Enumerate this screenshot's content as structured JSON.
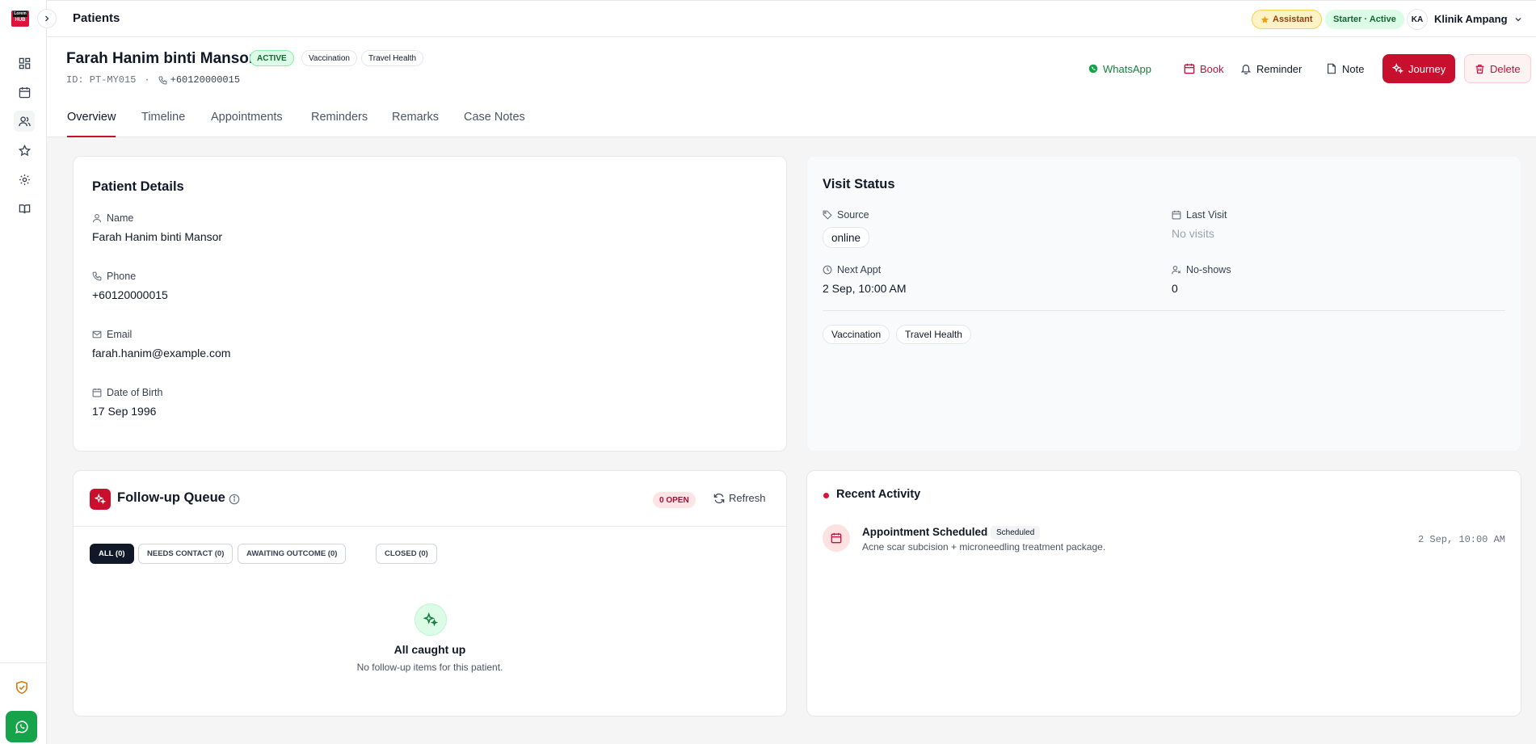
{
  "app": {
    "logo_top": "Lorem",
    "logo_bottom": "HUB"
  },
  "topbar": {
    "title": "Patients",
    "assistant_label": "Assistant",
    "plan_label": "Starter · Active",
    "avatar_initials": "KA",
    "clinic_name": "Klinik Ampang"
  },
  "patient": {
    "name": "Farah Hanim binti Mansor",
    "status_badge": "ACTIVE",
    "tags": [
      "Vaccination",
      "Travel Health"
    ],
    "id_label": "ID: PT-MY015",
    "separator": "·",
    "phone": "+60120000015"
  },
  "actions": {
    "whatsapp": "WhatsApp",
    "book": "Book",
    "reminder": "Reminder",
    "note": "Note",
    "journey": "Journey",
    "delete": "Delete"
  },
  "tabs": [
    "Overview",
    "Timeline",
    "Appointments",
    "Reminders",
    "Remarks",
    "Case Notes"
  ],
  "patient_details": {
    "title": "Patient Details",
    "name_label": "Name",
    "name_value": "Farah Hanim binti Mansor",
    "phone_label": "Phone",
    "phone_value": "+60120000015",
    "email_label": "Email",
    "email_value": "farah.hanim@example.com",
    "dob_label": "Date of Birth",
    "dob_value": "17 Sep 1996"
  },
  "visit_status": {
    "title": "Visit Status",
    "source_label": "Source",
    "source_value": "online",
    "last_visit_label": "Last Visit",
    "last_visit_value": "No visits",
    "next_appt_label": "Next Appt",
    "next_appt_value": "2 Sep, 10:00 AM",
    "noshows_label": "No-shows",
    "noshows_value": "0",
    "tags": [
      "Vaccination",
      "Travel Health"
    ]
  },
  "followup": {
    "title": "Follow-up Queue",
    "open_count": "0 OPEN",
    "refresh_label": "Refresh",
    "filters": [
      "ALL (0)",
      "NEEDS CONTACT (0)",
      "AWAITING OUTCOME (0)",
      "CLOSED (0)"
    ],
    "empty_title": "All caught up",
    "empty_text": "No follow-up items for this patient."
  },
  "activity": {
    "title": "Recent Activity",
    "items": [
      {
        "title": "Appointment Scheduled",
        "status": "Scheduled",
        "description": "Acne scar subcision + microneedling treatment package.",
        "time": "2 Sep, 10:00 AM"
      }
    ]
  },
  "colors": {
    "brand": "#c8102e",
    "whatsapp": "#16a34a",
    "active_badge": "#dcfce7"
  }
}
